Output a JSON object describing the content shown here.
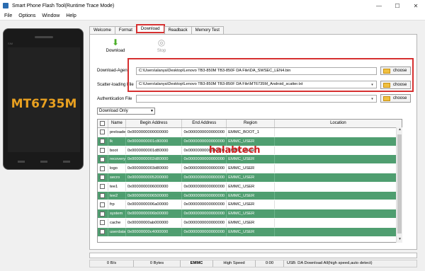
{
  "window": {
    "title": "Smart Phone Flash Tool(Runtime Trace Mode)",
    "controls": [
      "—",
      "☐",
      "✕"
    ]
  },
  "menu": [
    "File",
    "Options",
    "Window",
    "Help"
  ],
  "phone": {
    "chip": "MT6735M",
    "brand": "SIM"
  },
  "tabs": [
    "Welcome",
    "Format",
    "Download",
    "Readback",
    "Memory Test"
  ],
  "active_tab": "Download",
  "toolbar": {
    "download": "Download",
    "stop": "Stop"
  },
  "form": {
    "download_agent_label": "Download-Agent",
    "download_agent_value": "C:\\Users\\alanya\\Desktop\\Lenovo TB3-850M TB3-850F DA File\\DA_SWSEC_LEN4.bin",
    "scatter_label": "Scatter-loading File",
    "scatter_value": "C:\\Users\\alanya\\Desktop\\Lenovo TB3-850M TB3-850F DA File\\MT6735M_Android_scatter.txt",
    "auth_label": "Authentication File",
    "auth_value": "",
    "choose_label": "choose",
    "mode": "Download Only"
  },
  "table": {
    "headers": [
      "",
      "Name",
      "Begin Address",
      "End Address",
      "Region",
      "Location"
    ],
    "rows": [
      {
        "name": "preloader",
        "begin": "0x0000000000000000",
        "end": "0x0000000000000000",
        "region": "EMMC_BOOT_1",
        "location": "",
        "green": false
      },
      {
        "name": "lk",
        "begin": "0x0000000001c80000",
        "end": "0x0000000000000000",
        "region": "EMMC_USER",
        "location": "",
        "green": true
      },
      {
        "name": "boot",
        "begin": "0x0000000001d80000",
        "end": "0x0000000000000000",
        "region": "EMMC_USER",
        "location": "",
        "green": false
      },
      {
        "name": "recovery",
        "begin": "0x0000000002d80000",
        "end": "0x0000000000000000",
        "region": "EMMC_USER",
        "location": "",
        "green": true
      },
      {
        "name": "logo",
        "begin": "0x0000000003d80000",
        "end": "0x0000000000000000",
        "region": "EMMC_USER",
        "location": "",
        "green": false
      },
      {
        "name": "secro",
        "begin": "0x0000000005200000",
        "end": "0x0000000000000000",
        "region": "EMMC_USER",
        "location": "",
        "green": true
      },
      {
        "name": "tee1",
        "begin": "0x0000000006000000",
        "end": "0x0000000000000000",
        "region": "EMMC_USER",
        "location": "",
        "green": false
      },
      {
        "name": "tee2",
        "begin": "0x0000000006500000",
        "end": "0x0000000000000000",
        "region": "EMMC_USER",
        "location": "",
        "green": true
      },
      {
        "name": "frp",
        "begin": "0x0000000006a00000",
        "end": "0x0000000000000000",
        "region": "EMMC_USER",
        "location": "",
        "green": false
      },
      {
        "name": "system",
        "begin": "0x0000000006b00000",
        "end": "0x0000000000000000",
        "region": "EMMC_USER",
        "location": "",
        "green": true
      },
      {
        "name": "cache",
        "begin": "0x00000000ab000000",
        "end": "0x0000000000000000",
        "region": "EMMC_USER",
        "location": "",
        "green": false
      },
      {
        "name": "userdata",
        "begin": "0x00000000c4000000",
        "end": "0x0000000000000000",
        "region": "EMMC_USER",
        "location": "",
        "green": true
      }
    ]
  },
  "watermark": "halabtech",
  "progress_percent": 0,
  "status": {
    "speed": "0 B/s",
    "bytes": "0 Bytes",
    "storage": "EMMC",
    "mode": "High Speed",
    "time": "0:00",
    "info": "USB: DA Download All(high speed,auto detect)"
  }
}
